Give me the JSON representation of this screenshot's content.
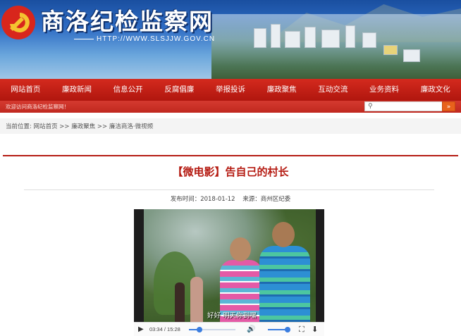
{
  "header": {
    "site_title": "商洛纪检监察网",
    "site_url": "HTTP://WWW.SLSJJW.GOV.CN"
  },
  "nav": {
    "items": [
      "网站首页",
      "廉政新闻",
      "信息公开",
      "反腐倡廉",
      "举报投诉",
      "廉政聚焦",
      "互动交流",
      "业务资料",
      "廉政文化"
    ]
  },
  "welcome": {
    "message": "欢迎访问商洛纪检监察网！",
    "search_placeholder": ""
  },
  "breadcrumb": {
    "text": "当前位置: 网站首页 >> 廉政聚焦 >> 廉洁商洛·微视频"
  },
  "article": {
    "title": "【微电影】告自己的村长",
    "publish_label": "发布时间：2018-01-12",
    "source_label": "来源：商州区纪委"
  },
  "video": {
    "subtitle": "好好 明天你到嘿",
    "time": "03:34 / 15:28",
    "progress": 0.23,
    "volume": 1.0
  },
  "colors": {
    "nav_red": "#c0281f",
    "title_red": "#b51b12",
    "accent_blue": "#3a7de0",
    "search_button": "#e8621c"
  },
  "icons": {
    "emblem": "party-emblem-icon",
    "search": "search-icon",
    "search_go": "double-chevron-right-icon",
    "play": "play-icon",
    "volume": "volume-icon",
    "fullscreen": "fullscreen-icon",
    "download": "download-icon"
  }
}
